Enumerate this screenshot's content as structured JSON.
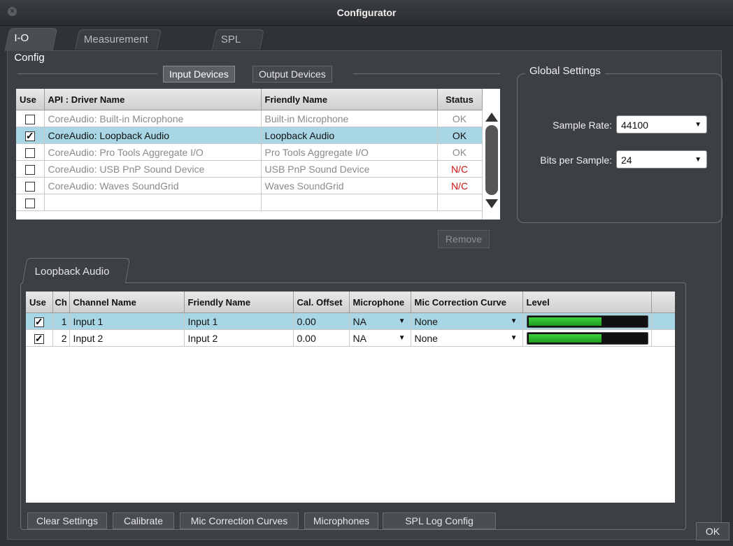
{
  "window": {
    "title": "Configurator"
  },
  "main_tabs": [
    {
      "label": "I-O Config",
      "active": true
    },
    {
      "label": "Measurement Config",
      "active": false
    },
    {
      "label": "SPL Config",
      "active": false
    }
  ],
  "device_toggle": {
    "input_label": "Input Devices",
    "output_label": "Output Devices",
    "selected": "Input Devices"
  },
  "devices_table": {
    "headers": {
      "use": "Use",
      "api": "API : Driver Name",
      "friendly": "Friendly Name",
      "status": "Status"
    },
    "rows": [
      {
        "use": false,
        "api": "CoreAudio: Built-in Microphone",
        "friendly": "Built-in Microphone",
        "status": "OK"
      },
      {
        "use": true,
        "api": "CoreAudio: Loopback Audio",
        "friendly": "Loopback Audio",
        "status": "OK"
      },
      {
        "use": false,
        "api": "CoreAudio: Pro Tools Aggregate I/O",
        "friendly": "Pro Tools Aggregate I/O",
        "status": "OK"
      },
      {
        "use": false,
        "api": "CoreAudio: USB PnP Sound Device",
        "friendly": "USB PnP Sound Device",
        "status": "N/C"
      },
      {
        "use": false,
        "api": "CoreAudio: Waves SoundGrid",
        "friendly": "Waves SoundGrid",
        "status": "N/C"
      }
    ],
    "remove_label": "Remove"
  },
  "global_settings": {
    "title": "Global Settings",
    "sample_rate_label": "Sample Rate:",
    "sample_rate_value": "44100",
    "bits_label": "Bits per Sample:",
    "bits_value": "24"
  },
  "device_tab": {
    "label": "Loopback Audio"
  },
  "channels_table": {
    "headers": {
      "use": "Use",
      "ch": "Ch",
      "channel_name": "Channel Name",
      "friendly": "Friendly Name",
      "cal_offset": "Cal. Offset",
      "microphone": "Microphone",
      "mic_curve": "Mic Correction Curve",
      "level": "Level"
    },
    "rows": [
      {
        "use": true,
        "ch": "1",
        "channel_name": "Input 1",
        "friendly": "Input 1",
        "cal_offset": "0.00",
        "microphone": "NA",
        "mic_curve": "None",
        "level": 0.62
      },
      {
        "use": true,
        "ch": "2",
        "channel_name": "Input 2",
        "friendly": "Input 2",
        "cal_offset": "0.00",
        "microphone": "NA",
        "mic_curve": "None",
        "level": 0.62
      }
    ]
  },
  "bottom_buttons": {
    "clear": "Clear Settings",
    "calibrate": "Calibrate",
    "mic_curves": "Mic Correction Curves",
    "microphones": "Microphones",
    "spl_log": "SPL Log Config"
  },
  "ok_label": "OK",
  "colors": {
    "selected_row": "#a9d6e4",
    "nc_status": "#cc1111",
    "meter_green": "#2fbf2f"
  }
}
